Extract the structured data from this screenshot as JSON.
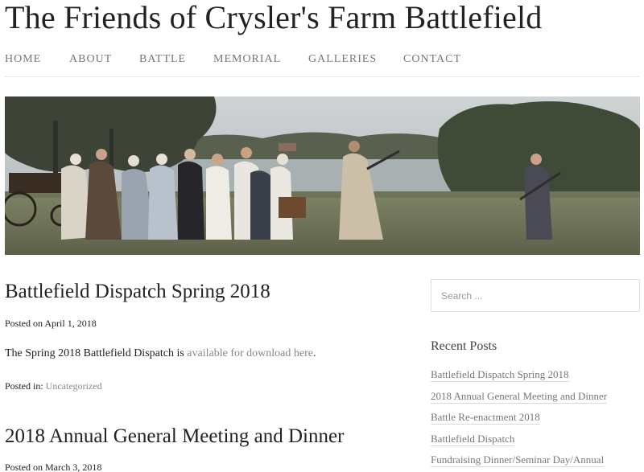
{
  "site": {
    "title": "The Friends of Crysler's Farm Battlefield"
  },
  "nav": {
    "items": [
      {
        "label": "HOME"
      },
      {
        "label": "ABOUT"
      },
      {
        "label": "BATTLE"
      },
      {
        "label": "MEMORIAL"
      },
      {
        "label": "GALLERIES"
      },
      {
        "label": "CONTACT"
      }
    ]
  },
  "hero": {
    "description": "photo-of-period-reenactors-walking-across-field-by-river"
  },
  "posts": [
    {
      "title": "Battlefield Dispatch Spring 2018",
      "meta_prefix": "Posted on",
      "date": "April 1, 2018",
      "body_text": "The Spring 2018 Battlefield Dispatch is",
      "body_link": "available for download here",
      "body_suffix": ".",
      "category_prefix": "Posted in:",
      "category": "Uncategorized"
    },
    {
      "title": "2018 Annual General Meeting and Dinner",
      "meta_prefix": "Posted on",
      "date": "March 3, 2018"
    }
  ],
  "sidebar": {
    "search_placeholder": "Search ...",
    "recent_title": "Recent Posts",
    "recent_posts": [
      "Battlefield Dispatch Spring 2018",
      "2018 Annual General Meeting and Dinner",
      "Battle Re-enactment 2018",
      "Battlefield Dispatch",
      "Fundraising Dinner/Seminar Day/Annual"
    ]
  },
  "colors": {
    "text": "#222222",
    "muted": "#777777",
    "link": "#888888",
    "divider": "#e8e8e8"
  }
}
